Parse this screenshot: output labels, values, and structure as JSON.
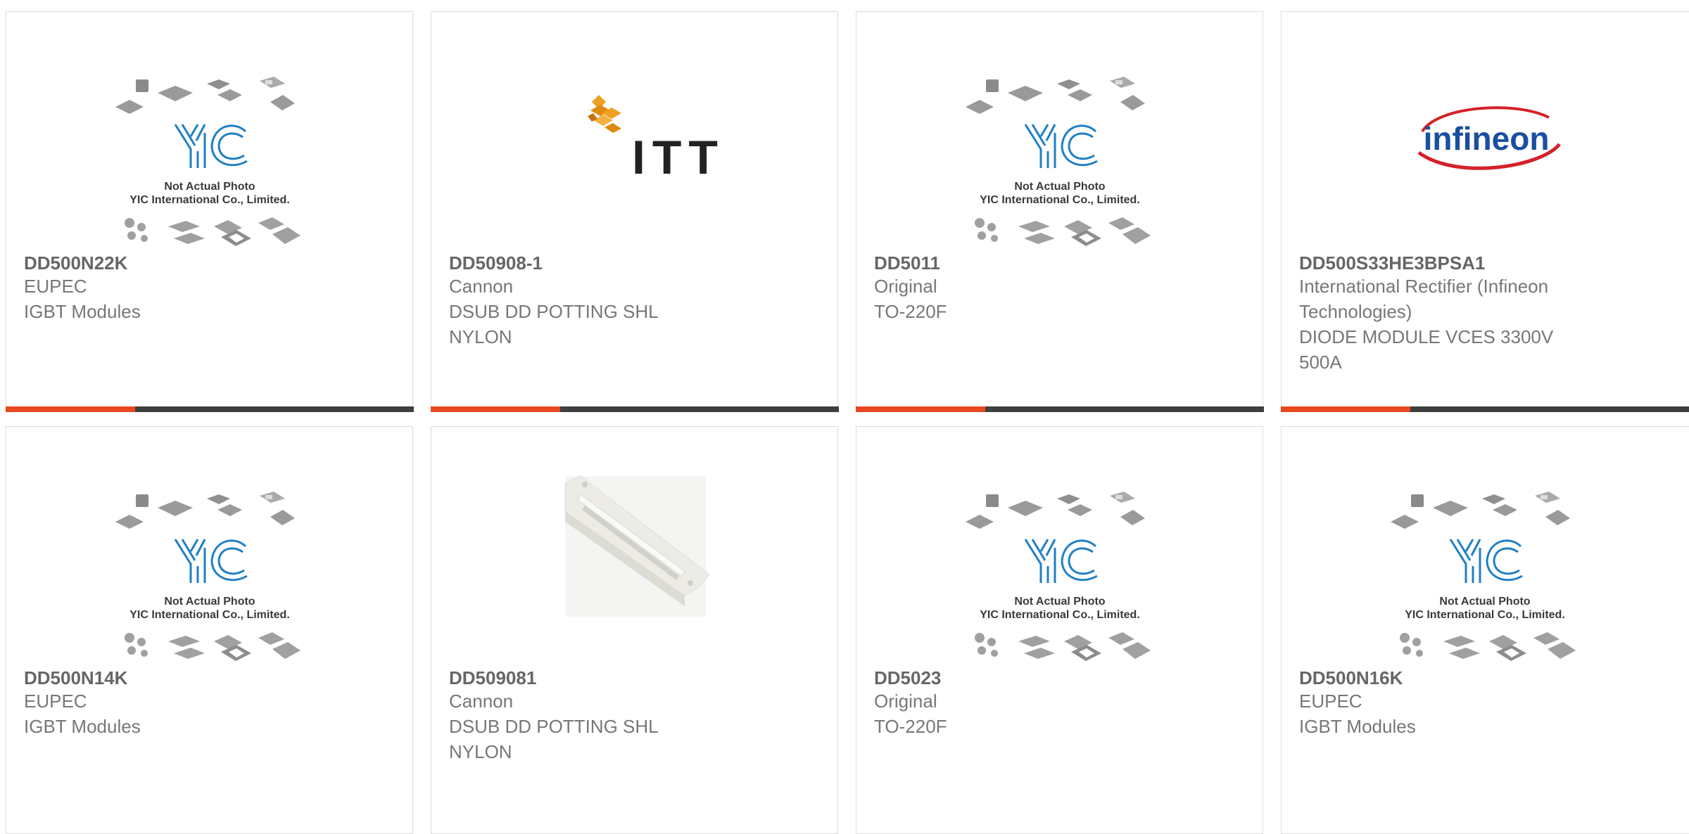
{
  "placeholder": {
    "line1": "Not Actual Photo",
    "line2": "YIC International Co., Limited."
  },
  "logos": {
    "itt": "ITT",
    "infineon": "infineon"
  },
  "products": [
    {
      "part_number": "DD500N22K",
      "manufacturer": "EUPEC",
      "description_lines": [
        "IGBT Modules"
      ],
      "image": "yic-placeholder"
    },
    {
      "part_number": "DD50908-1",
      "manufacturer": "Cannon",
      "description_lines": [
        "DSUB DD POTTING SHL",
        "NYLON"
      ],
      "image": "itt-logo"
    },
    {
      "part_number": "DD5011",
      "manufacturer": "Original",
      "description_lines": [
        "TO-220F"
      ],
      "image": "yic-placeholder"
    },
    {
      "part_number": "DD500S33HE3BPSA1",
      "manufacturer_lines": [
        "International Rectifier (Infineon",
        "Technologies)"
      ],
      "description_lines": [
        "DIODE MODULE VCES 3300V",
        "500A"
      ],
      "image": "infineon-logo"
    },
    {
      "part_number": "DD500N14K",
      "manufacturer": "EUPEC",
      "description_lines": [
        "IGBT Modules"
      ],
      "image": "yic-placeholder"
    },
    {
      "part_number": "DD509081",
      "manufacturer": "Cannon",
      "description_lines": [
        "DSUB DD POTTING SHL",
        "NYLON"
      ],
      "image": "potting-shell-photo"
    },
    {
      "part_number": "DD5023",
      "manufacturer": "Original",
      "description_lines": [
        "TO-220F"
      ],
      "image": "yic-placeholder"
    },
    {
      "part_number": "DD500N16K",
      "manufacturer": "EUPEC",
      "description_lines": [
        "IGBT Modules"
      ],
      "image": "yic-placeholder"
    }
  ],
  "colors": {
    "accent": "#e8481e",
    "bar": "#3f3f3f",
    "yic_blue": "#1f7fc4",
    "infineon_blue": "#1a4fa0",
    "infineon_red": "#d4212a",
    "itt_orange": "#f0a020"
  }
}
